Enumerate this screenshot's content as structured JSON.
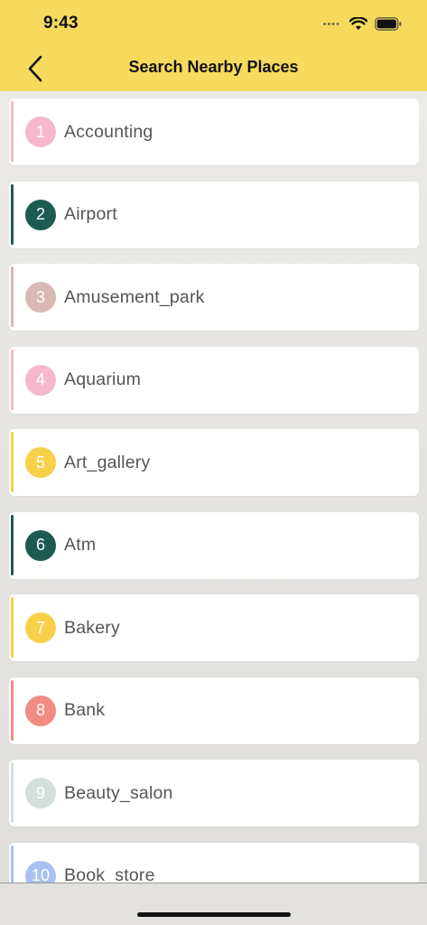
{
  "status_bar": {
    "time": "9:43"
  },
  "nav": {
    "title": "Search Nearby Places",
    "back_icon": "chevron-left-icon"
  },
  "places": [
    {
      "number": "1",
      "name": "Accounting",
      "color": "#f5b8cc"
    },
    {
      "number": "2",
      "name": "Airport",
      "color": "#1d5a52"
    },
    {
      "number": "3",
      "name": "Amusement_park",
      "color": "#d8b9b4"
    },
    {
      "number": "4",
      "name": "Aquarium",
      "color": "#f5b8cc"
    },
    {
      "number": "5",
      "name": "Art_gallery",
      "color": "#f9d04a"
    },
    {
      "number": "6",
      "name": "Atm",
      "color": "#1d5a52"
    },
    {
      "number": "7",
      "name": "Bakery",
      "color": "#f9d04a"
    },
    {
      "number": "8",
      "name": "Bank",
      "color": "#f28b82"
    },
    {
      "number": "9",
      "name": "Beauty_salon",
      "color": "#d3dedd"
    },
    {
      "number": "10",
      "name": "Book_store",
      "color": "#a8c1f2"
    }
  ],
  "colors": {
    "header": "#f7da5d",
    "background": "#e6e5e2"
  }
}
